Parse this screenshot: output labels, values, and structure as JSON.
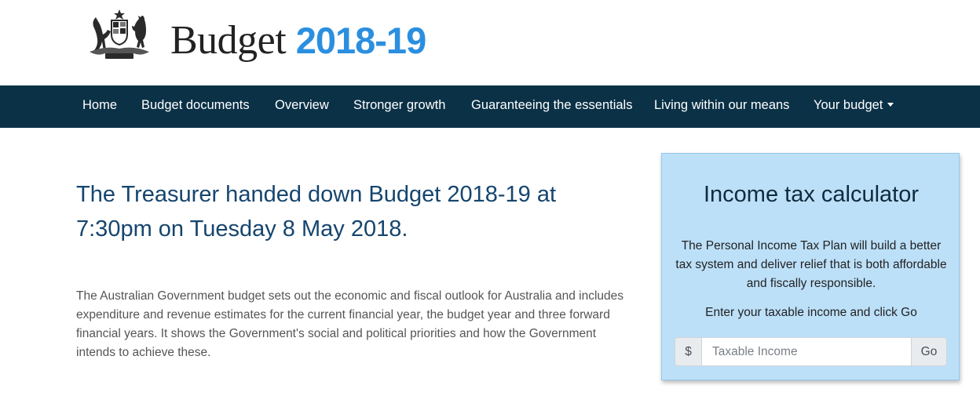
{
  "header": {
    "crest_icon": "commonwealth-coat-of-arms-icon",
    "brand_word": "Budget",
    "brand_year": "2018-19"
  },
  "nav": {
    "items": [
      {
        "label": "Home"
      },
      {
        "label": "Budget documents"
      },
      {
        "label": "Overview"
      },
      {
        "label": "Stronger growth"
      },
      {
        "label": "Guaranteeing the essentials"
      },
      {
        "label": "Living within our means"
      },
      {
        "label": "Your budget"
      }
    ]
  },
  "main": {
    "headline": "The Treasurer handed down Budget 2018-19 at 7:30pm on Tuesday 8 May 2018.",
    "intro": "The Australian Government budget sets out the economic and fiscal outlook for Australia and includes expenditure and revenue estimates for the current financial year, the budget year and three forward financial years. It shows the Government's social and political priorities and how the Government intends to achieve these."
  },
  "calculator": {
    "title": "Income tax calculator",
    "description": "The Personal Income Tax Plan will build a better tax system and deliver relief that is both affordable and fiscally responsible.",
    "prompt": "Enter your taxable income and click Go",
    "currency_symbol": "$",
    "input_value": "",
    "input_placeholder": "Taxable Income",
    "go_label": "Go"
  },
  "colors": {
    "nav_background": "#0b3147",
    "brand_year": "#2b8fe0",
    "headline": "#15456e",
    "calculator_background": "#bde0f9"
  }
}
